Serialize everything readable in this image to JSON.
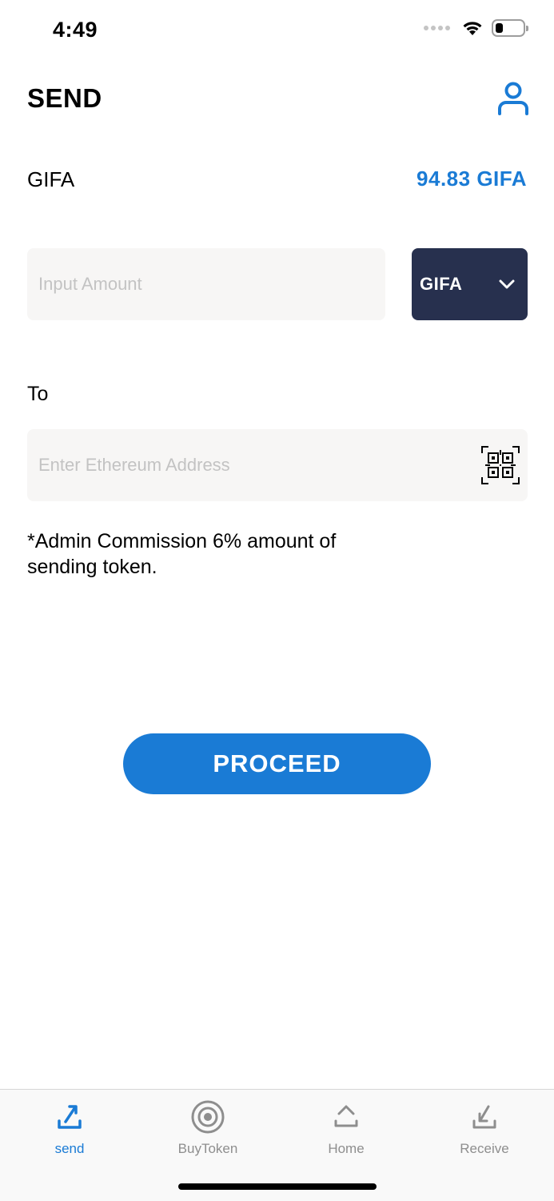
{
  "status_bar": {
    "time": "4:49"
  },
  "header": {
    "title": "SEND"
  },
  "balance": {
    "token_label": "GIFA",
    "value": "94.83 GIFA"
  },
  "amount": {
    "placeholder": "Input Amount",
    "value": ""
  },
  "token_select": {
    "selected": "GIFA"
  },
  "to": {
    "label": "To",
    "placeholder": "Enter Ethereum Address",
    "value": ""
  },
  "note": "*Admin Commission 6% amount of sending token.",
  "proceed_label": "PROCEED",
  "tabs": [
    {
      "label": "send",
      "icon": "send-icon",
      "active": true
    },
    {
      "label": "BuyToken",
      "icon": "target-icon",
      "active": false
    },
    {
      "label": "Home",
      "icon": "home-icon",
      "active": false
    },
    {
      "label": "Receive",
      "icon": "receive-icon",
      "active": false
    }
  ],
  "colors": {
    "accent": "#1a7bd5",
    "dark_button": "#27304e",
    "input_bg": "#f7f6f5"
  }
}
